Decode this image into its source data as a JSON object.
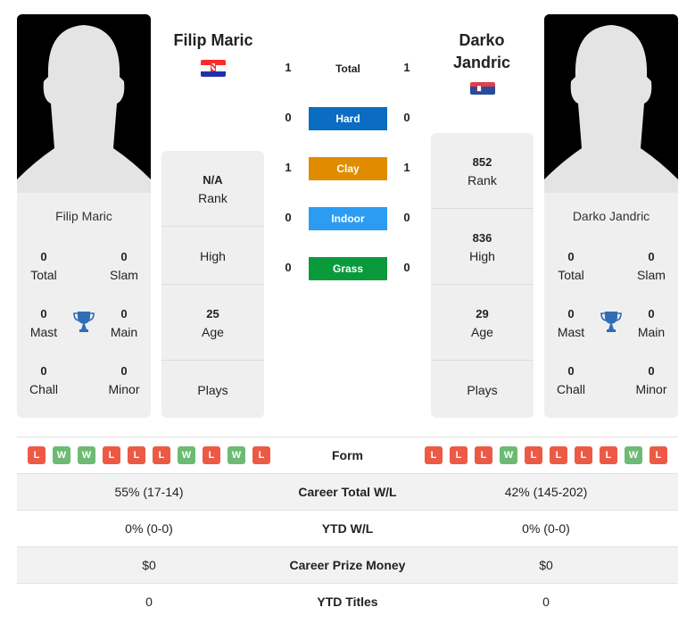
{
  "player1": {
    "name": "Filip Maric",
    "card_name": "Filip Maric",
    "flag": "croatia-flag",
    "titles": {
      "total": {
        "value": "0",
        "label": "Total"
      },
      "slam": {
        "value": "0",
        "label": "Slam"
      },
      "mast": {
        "value": "0",
        "label": "Mast"
      },
      "main": {
        "value": "0",
        "label": "Main"
      },
      "chall": {
        "value": "0",
        "label": "Chall"
      },
      "minor": {
        "value": "0",
        "label": "Minor"
      }
    },
    "rank": {
      "value": "N/A",
      "label": "Rank"
    },
    "high": {
      "value": "",
      "label": "High"
    },
    "age": {
      "value": "25",
      "label": "Age"
    },
    "plays": {
      "value": "",
      "label": "Plays"
    },
    "form": [
      "L",
      "W",
      "W",
      "L",
      "L",
      "L",
      "W",
      "L",
      "W",
      "L"
    ]
  },
  "player2": {
    "name_line1": "Darko",
    "name_line2": "Jandric",
    "card_name": "Darko Jandric",
    "flag": "serbia-flag",
    "titles": {
      "total": {
        "value": "0",
        "label": "Total"
      },
      "slam": {
        "value": "0",
        "label": "Slam"
      },
      "mast": {
        "value": "0",
        "label": "Mast"
      },
      "main": {
        "value": "0",
        "label": "Main"
      },
      "chall": {
        "value": "0",
        "label": "Chall"
      },
      "minor": {
        "value": "0",
        "label": "Minor"
      }
    },
    "rank": {
      "value": "852",
      "label": "Rank"
    },
    "high": {
      "value": "836",
      "label": "High"
    },
    "age": {
      "value": "29",
      "label": "Age"
    },
    "plays": {
      "value": "",
      "label": "Plays"
    },
    "form": [
      "L",
      "L",
      "L",
      "W",
      "L",
      "L",
      "L",
      "L",
      "W",
      "L"
    ]
  },
  "h2h": {
    "total": {
      "label": "Total",
      "p1": "1",
      "p2": "1"
    },
    "surfaces": [
      {
        "label": "Hard",
        "p1": "0",
        "p2": "0",
        "color": "#0a6cc2"
      },
      {
        "label": "Clay",
        "p1": "1",
        "p2": "1",
        "color": "#e08c00"
      },
      {
        "label": "Indoor",
        "p1": "0",
        "p2": "0",
        "color": "#2b9cf2"
      },
      {
        "label": "Grass",
        "p1": "0",
        "p2": "0",
        "color": "#0a9a3c"
      }
    ]
  },
  "comparison": {
    "form_label": "Form",
    "rows": [
      {
        "label": "Career Total W/L",
        "p1": "55% (17-14)",
        "p2": "42% (145-202)"
      },
      {
        "label": "YTD W/L",
        "p1": "0% (0-0)",
        "p2": "0% (0-0)"
      },
      {
        "label": "Career Prize Money",
        "p1": "$0",
        "p2": "$0"
      },
      {
        "label": "YTD Titles",
        "p1": "0",
        "p2": "0"
      }
    ]
  }
}
